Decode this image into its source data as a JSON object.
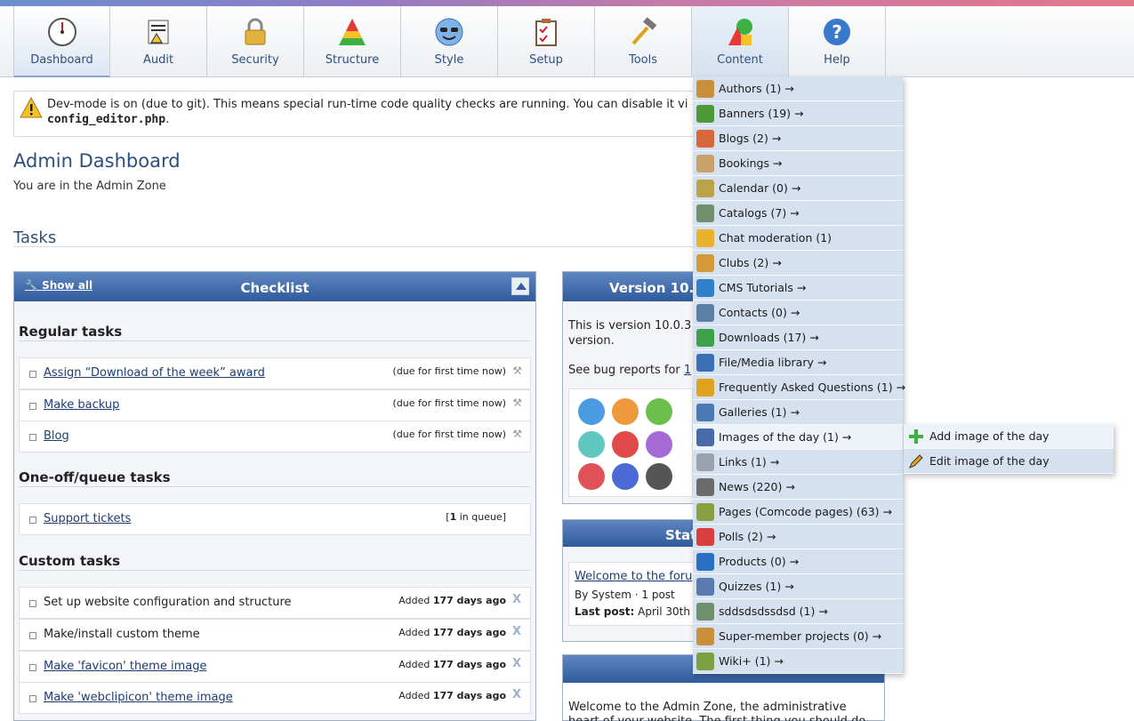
{
  "toolbar": {
    "items": [
      {
        "label": "Dashboard",
        "icon": "dashboard-gauge-icon"
      },
      {
        "label": "Audit",
        "icon": "audit-icon"
      },
      {
        "label": "Security",
        "icon": "padlock-icon"
      },
      {
        "label": "Structure",
        "icon": "structure-pyramid-icon"
      },
      {
        "label": "Style",
        "icon": "style-smiley-icon"
      },
      {
        "label": "Setup",
        "icon": "setup-clipboard-icon"
      },
      {
        "label": "Tools",
        "icon": "tools-hammer-icon"
      },
      {
        "label": "Content",
        "icon": "content-shapes-icon"
      },
      {
        "label": "Help",
        "icon": "help-question-icon"
      }
    ]
  },
  "notice": {
    "line1": "Dev-mode is on (due to git). This means special run-time code quality checks are running. You can disable it vi",
    "line2_code": "config_editor.php",
    "line2_tail": "."
  },
  "page": {
    "title": "Admin Dashboard",
    "subtitle": "You are in the Admin Zone",
    "tasks_heading": "Tasks"
  },
  "checklist": {
    "title": "Checklist",
    "show_all": "Show all",
    "regular_heading": "Regular tasks",
    "oneoff_heading": "One-off/queue tasks",
    "custom_heading": "Custom tasks",
    "regular": [
      {
        "name": "Assign “Download of the week” award",
        "status": "(due for first time now)"
      },
      {
        "name": "Make backup",
        "status": "(due for first time now)"
      },
      {
        "name": "Blog",
        "status": "(due for first time now)"
      }
    ],
    "oneoff": [
      {
        "name": "Support tickets",
        "status_pre": "[",
        "status_num": "1",
        "status_post": " in queue]"
      }
    ],
    "custom": [
      {
        "name": "Set up website configuration and structure",
        "added": "Added",
        "age": "177 days ago",
        "link": false
      },
      {
        "name": "Make/install custom theme",
        "added": "Added",
        "age": "177 days ago",
        "link": false
      },
      {
        "name": "Make 'favicon' theme image",
        "added": "Added",
        "age": "177 days ago",
        "link": true
      },
      {
        "name": "Make 'webclipicon' theme image",
        "added": "Added",
        "age": "177 days ago",
        "link": true
      }
    ],
    "remove_glyph": "X"
  },
  "version": {
    "title": "Version 10.",
    "text1": "This is version 10.0.3",
    "text1b": "version.",
    "text2_pre": "See bug reports for ",
    "text2_link": "1"
  },
  "stats": {
    "title": "Stat",
    "forum_link": "Welcome to the foru",
    "by": "By System",
    "sep": "·",
    "posts": "1 post",
    "last_label": "Last post:",
    "last_value": "April 30th 2"
  },
  "welcome": {
    "text": "Welcome to the Admin Zone, the administrative heart of your website. The first thing you should do"
  },
  "content_menu": {
    "items": [
      {
        "label": "Authors (1) →",
        "icon": "authors-icon",
        "color": "#c98f3a"
      },
      {
        "label": "Banners (19) →",
        "icon": "banners-icon",
        "color": "#4e9a3a"
      },
      {
        "label": "Blogs (2) →",
        "icon": "blogs-icon",
        "color": "#d8673a"
      },
      {
        "label": "Bookings →",
        "icon": "bookings-icon",
        "color": "#c7a06a"
      },
      {
        "label": "Calendar (0) →",
        "icon": "calendar-icon",
        "color": "#b9a24a"
      },
      {
        "label": "Catalogs (7) →",
        "icon": "catalogs-icon",
        "color": "#6e8e6e"
      },
      {
        "label": "Chat moderation (1)",
        "icon": "chat-icon",
        "color": "#e8b22a"
      },
      {
        "label": "Clubs (2) →",
        "icon": "clubs-icon",
        "color": "#d49a3a"
      },
      {
        "label": "CMS Tutorials →",
        "icon": "tutorials-icon",
        "color": "#2f7fc9"
      },
      {
        "label": "Contacts (0) →",
        "icon": "contacts-icon",
        "color": "#5c7fa8"
      },
      {
        "label": "Downloads (17) →",
        "icon": "downloads-icon",
        "color": "#3fa04a"
      },
      {
        "label": "File/Media library →",
        "icon": "media-library-icon",
        "color": "#3b6fb5"
      },
      {
        "label": "Frequently Asked Questions (1) →",
        "icon": "faq-icon",
        "color": "#e0a21e"
      },
      {
        "label": "Galleries (1) →",
        "icon": "galleries-icon",
        "color": "#4a79b3"
      },
      {
        "label": "Images of the day (1) →",
        "icon": "images-of-day-icon",
        "color": "#4a69a8"
      },
      {
        "label": "Links (1) →",
        "icon": "links-icon",
        "color": "#9aa3ad"
      },
      {
        "label": "News (220) →",
        "icon": "news-icon",
        "color": "#6b6b6b"
      },
      {
        "label": "Pages (Comcode pages) (63) →",
        "icon": "pages-icon",
        "color": "#8aa040"
      },
      {
        "label": "Polls (2) →",
        "icon": "polls-icon",
        "color": "#d84040"
      },
      {
        "label": "Products (0) →",
        "icon": "products-icon",
        "color": "#2a6fc4"
      },
      {
        "label": "Quizzes (1) →",
        "icon": "quizzes-icon",
        "color": "#5a7bb0"
      },
      {
        "label": "sddsdsdssdsd (1) →",
        "icon": "catalog-entry-icon",
        "color": "#6e8e6e"
      },
      {
        "label": "Super-member projects (0) →",
        "icon": "projects-icon",
        "color": "#c98f3a"
      },
      {
        "label": "Wiki+ (1) →",
        "icon": "wiki-icon",
        "color": "#7aa040"
      }
    ]
  },
  "submenu": {
    "items": [
      {
        "label": "Add image of the day",
        "icon": "plus-icon"
      },
      {
        "label": "Edit image of the day",
        "icon": "pencil-icon"
      }
    ]
  }
}
